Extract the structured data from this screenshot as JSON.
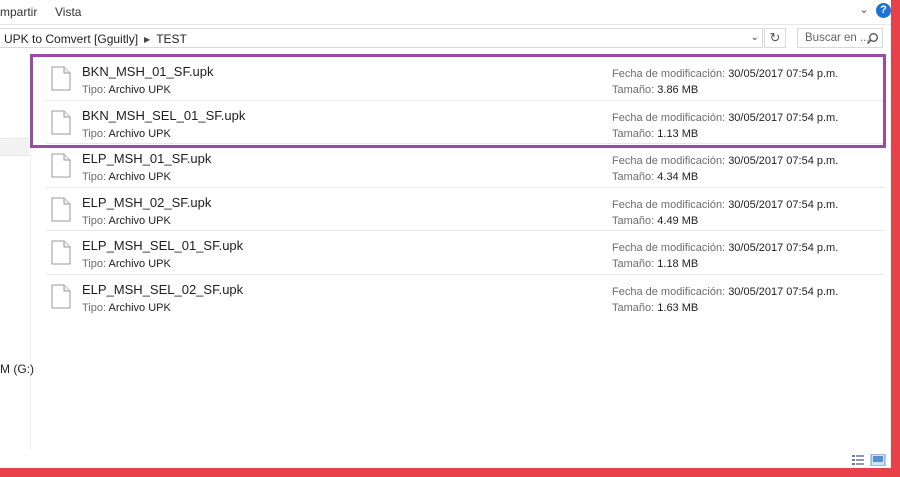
{
  "ribbon": {
    "tabs": [
      "mpartir",
      "Vista"
    ]
  },
  "address": {
    "segments": [
      "UPK to Comvert [Gguitly]",
      "TEST"
    ]
  },
  "search": {
    "placeholder": "Buscar en ..."
  },
  "nav": {
    "drive_label": "M (G:)"
  },
  "labels": {
    "type": "Tipo:",
    "modified": "Fecha de modificación:",
    "size": "Tamaño:"
  },
  "files": [
    {
      "name": "BKN_MSH_01_SF.upk",
      "type": "Archivo UPK",
      "modified": "30/05/2017 07:54 p.m.",
      "size": "3.86 MB",
      "selected": true
    },
    {
      "name": "BKN_MSH_SEL_01_SF.upk",
      "type": "Archivo UPK",
      "modified": "30/05/2017 07:54 p.m.",
      "size": "1.13 MB",
      "selected": true
    },
    {
      "name": "ELP_MSH_01_SF.upk",
      "type": "Archivo UPK",
      "modified": "30/05/2017 07:54 p.m.",
      "size": "4.34 MB",
      "selected": false
    },
    {
      "name": "ELP_MSH_02_SF.upk",
      "type": "Archivo UPK",
      "modified": "30/05/2017 07:54 p.m.",
      "size": "4.49 MB",
      "selected": false
    },
    {
      "name": "ELP_MSH_SEL_01_SF.upk",
      "type": "Archivo UPK",
      "modified": "30/05/2017 07:54 p.m.",
      "size": "1.18 MB",
      "selected": false
    },
    {
      "name": "ELP_MSH_SEL_02_SF.upk",
      "type": "Archivo UPK",
      "modified": "30/05/2017 07:54 p.m.",
      "size": "1.63 MB",
      "selected": false
    }
  ],
  "colors": {
    "frame": "#e8414a",
    "highlight": "#9b4aa6",
    "help": "#1a73d9"
  }
}
